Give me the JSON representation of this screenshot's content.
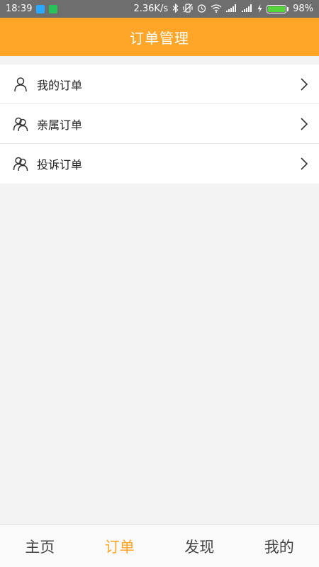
{
  "status_bar": {
    "time": "18:39",
    "network_speed": "2.36K/s",
    "battery_percent": "98%",
    "battery_level": 0.98,
    "icons": [
      "app-notification-icon",
      "android-icon",
      "bluetooth-icon",
      "vibrate-icon",
      "alarm-icon",
      "wifi-icon",
      "signal-icon",
      "signal-icon",
      "charging-icon"
    ]
  },
  "header": {
    "title": "订单管理"
  },
  "menu": {
    "items": [
      {
        "label": "我的订单",
        "icon": "person-icon"
      },
      {
        "label": "亲属订单",
        "icon": "people-icon"
      },
      {
        "label": "投诉订单",
        "icon": "people-icon"
      }
    ]
  },
  "bottom_nav": {
    "items": [
      {
        "label": "主页",
        "active": false
      },
      {
        "label": "订单",
        "active": true
      },
      {
        "label": "发现",
        "active": false
      },
      {
        "label": "我的",
        "active": false
      }
    ]
  },
  "colors": {
    "accent": "#ffa628",
    "status_bar": "#6e6e6e",
    "background": "#f3f3f3"
  }
}
